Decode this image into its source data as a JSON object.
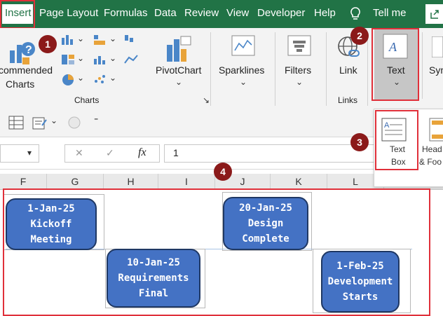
{
  "tabs": {
    "insert": "Insert",
    "page_layout": "Page Layout",
    "formulas": "Formulas",
    "data": "Data",
    "review": "Review",
    "view": "View",
    "developer": "Developer",
    "help": "Help",
    "tell_me": "Tell me"
  },
  "ribbon": {
    "recommended_charts_line1": "commended",
    "recommended_charts_line2": "Charts",
    "pivotchart": "PivotChart",
    "charts_group": "Charts",
    "sparklines": "Sparklines",
    "filters": "Filters",
    "link": "Link",
    "links_group": "Links",
    "text": "Text",
    "symbols_partial": "Sym",
    "dropdown_arrow": "⌄"
  },
  "dropdown": {
    "text_box_line1": "Text",
    "text_box_line2": "Box",
    "header_footer_line1": "Head",
    "header_footer_line2": "& Foo"
  },
  "formula_bar": {
    "cancel": "✕",
    "enter": "✓",
    "fx": "fx",
    "value": "1"
  },
  "columns": [
    "F",
    "G",
    "H",
    "I",
    "J",
    "K",
    "L"
  ],
  "badges": [
    "1",
    "2",
    "3",
    "4"
  ],
  "milestones": [
    {
      "date": "1-Jan-25",
      "line2": "Kickoff",
      "line3": "Meeting"
    },
    {
      "date": "10-Jan-25",
      "line2": "Requirements",
      "line3": "Final"
    },
    {
      "date": "20-Jan-25",
      "line2": "Design",
      "line3": "Complete"
    },
    {
      "date": "1-Feb-25",
      "line2": "Development",
      "line3": "Starts"
    }
  ],
  "colors": {
    "excel_green": "#217346",
    "box_fill": "#4472c4",
    "highlight_red": "#e0303a",
    "badge_red": "#8b1a1a"
  }
}
